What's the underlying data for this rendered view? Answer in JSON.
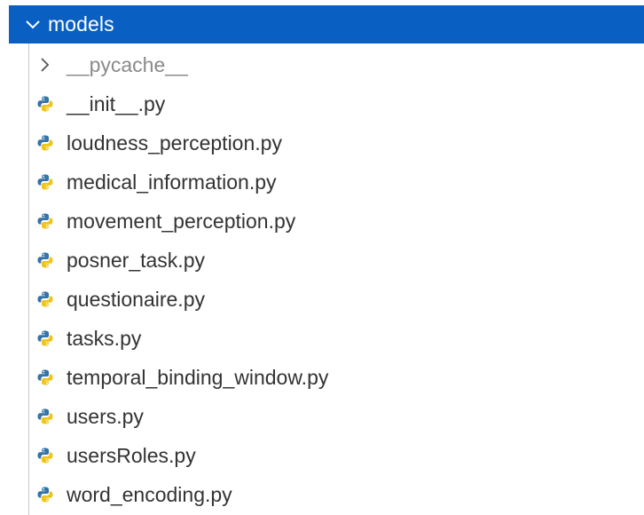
{
  "explorer": {
    "folder": {
      "name": "models",
      "expanded": true,
      "chevron_icon": "chevron-down-icon"
    },
    "items": [
      {
        "label": "__pycache__",
        "kind": "folder",
        "icon": "chevron-right-icon",
        "dimmed": true
      },
      {
        "label": "__init__.py",
        "kind": "python-file",
        "icon": "python-icon"
      },
      {
        "label": "loudness_perception.py",
        "kind": "python-file",
        "icon": "python-icon"
      },
      {
        "label": "medical_information.py",
        "kind": "python-file",
        "icon": "python-icon"
      },
      {
        "label": "movement_perception.py",
        "kind": "python-file",
        "icon": "python-icon"
      },
      {
        "label": "posner_task.py",
        "kind": "python-file",
        "icon": "python-icon"
      },
      {
        "label": "questionaire.py",
        "kind": "python-file",
        "icon": "python-icon"
      },
      {
        "label": "tasks.py",
        "kind": "python-file",
        "icon": "python-icon"
      },
      {
        "label": "temporal_binding_window.py",
        "kind": "python-file",
        "icon": "python-icon"
      },
      {
        "label": "users.py",
        "kind": "python-file",
        "icon": "python-icon"
      },
      {
        "label": "usersRoles.py",
        "kind": "python-file",
        "icon": "python-icon"
      },
      {
        "label": "word_encoding.py",
        "kind": "python-file",
        "icon": "python-icon"
      }
    ]
  },
  "colors": {
    "selection_background": "#0a60c2",
    "selection_text": "#ffffff",
    "file_text": "#333333",
    "dimmed_text": "#8a8a8a",
    "python_blue": "#3572a5",
    "python_yellow": "#f0c419"
  }
}
